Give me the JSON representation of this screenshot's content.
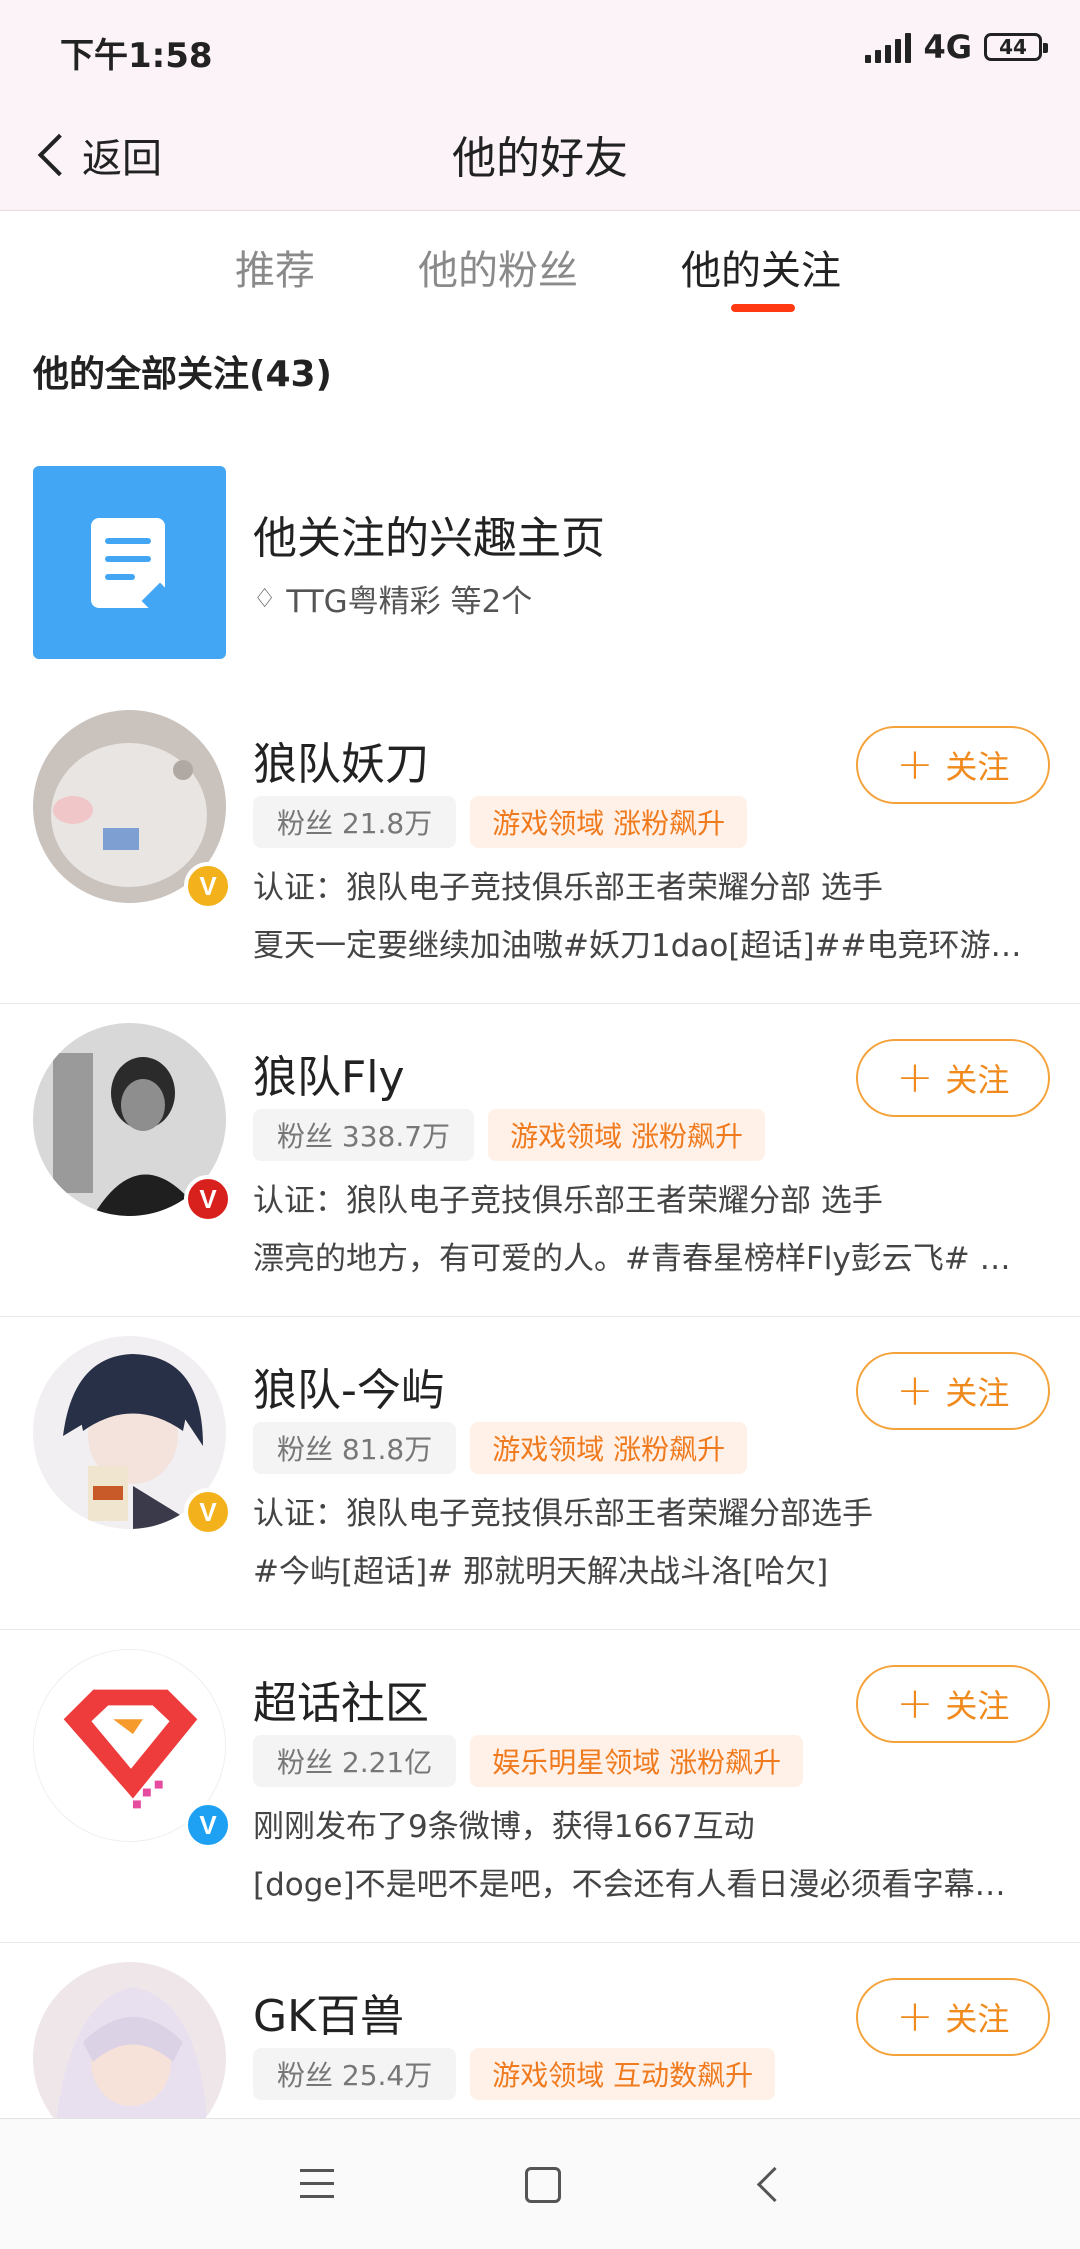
{
  "status": {
    "time": "下午1:58",
    "network": "4G",
    "battery": "44"
  },
  "nav": {
    "back_label": "返回",
    "title": "他的好友"
  },
  "tabs": [
    {
      "label": "推荐"
    },
    {
      "label": "他的粉丝"
    },
    {
      "label": "他的关注",
      "active": true
    }
  ],
  "section_title": "他的全部关注(43)",
  "interest": {
    "title": "他关注的兴趣主页",
    "subtitle": "TTG粤精彩 等2个"
  },
  "follow_label": "关注",
  "users": [
    {
      "name": "狼队妖刀",
      "fans": "粉丝 21.8万",
      "tag": "游戏领域 涨粉飙升",
      "line1": "认证：狼队电子竞技俱乐部王者荣耀分部 选手",
      "line2": "夏天一定要继续加油嗷#妖刀1dao[超话]##电竞环游…",
      "badge": "gold"
    },
    {
      "name": "狼队Fly",
      "fans": "粉丝 338.7万",
      "tag": "游戏领域 涨粉飙升",
      "line1": "认证：狼队电子竞技俱乐部王者荣耀分部 选手",
      "line2": "漂亮的地方，有可爱的人。#青春星榜样Fly彭云飞# #…",
      "badge": "red"
    },
    {
      "name": "狼队-今屿",
      "fans": "粉丝 81.8万",
      "tag": "游戏领域 涨粉飙升",
      "line1": "认证：狼队电子竞技俱乐部王者荣耀分部选手",
      "line2": "#今屿[超话]# 那就明天解决战斗洛[哈欠]",
      "badge": "gold"
    },
    {
      "name": "超话社区",
      "fans": "粉丝 2.21亿",
      "tag": "娱乐明星领域 涨粉飙升",
      "line1": "刚刚发布了9条微博，获得1667互动",
      "line2": "[doge]不是吧不是吧，不会还有人看日漫必须看字幕…",
      "badge": "blue"
    },
    {
      "name": "GK百兽",
      "fans": "粉丝 25.4万",
      "tag": "游戏领域 互动数飙升"
    }
  ],
  "colors": {
    "accent": "#f08a1c",
    "tab_underline": "#ff3a12",
    "interest_icon": "#43a6f5"
  }
}
